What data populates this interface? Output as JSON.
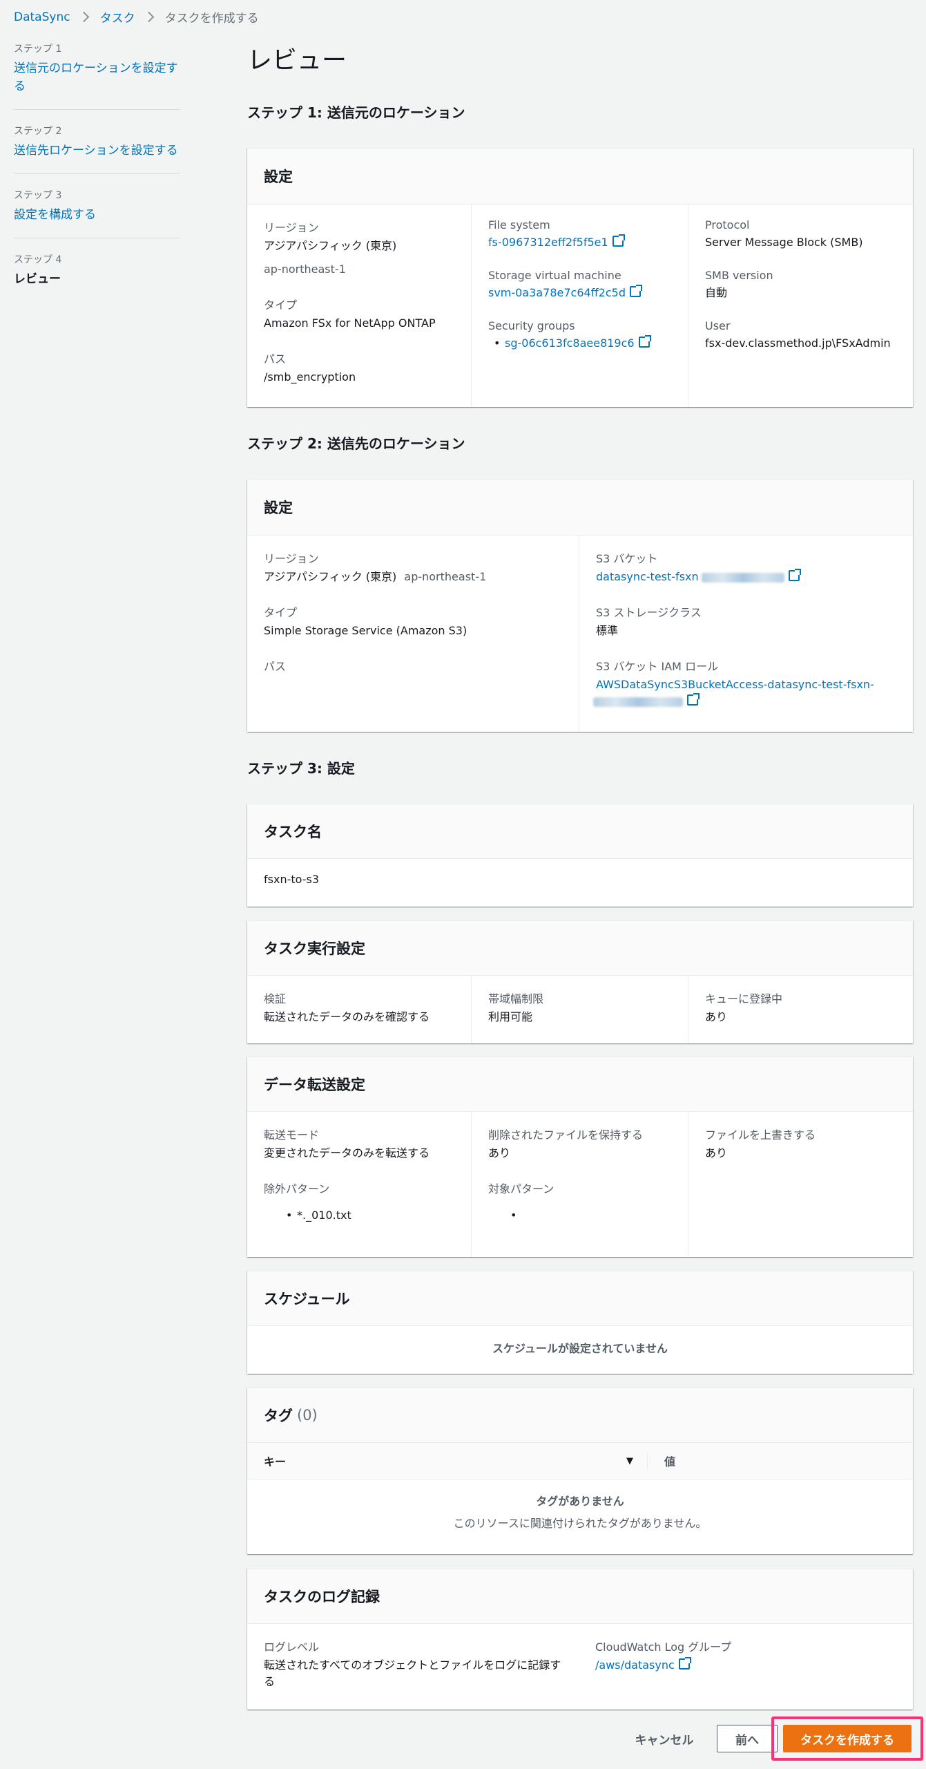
{
  "breadcrumb": {
    "items": [
      "DataSync",
      "タスク"
    ],
    "current": "タスクを作成する"
  },
  "nav": {
    "steps": [
      {
        "small": "ステップ 1",
        "label": "送信元のロケーションを設定する"
      },
      {
        "small": "ステップ 2",
        "label": "送信先ロケーションを設定する"
      },
      {
        "small": "ステップ 3",
        "label": "設定を構成する"
      },
      {
        "small": "ステップ 4",
        "label": "レビュー"
      }
    ]
  },
  "page_title": "レビュー",
  "step1": {
    "heading": "ステップ 1: 送信元のロケーション",
    "card_title": "設定",
    "region_label": "リージョン",
    "region_value": "アジアパシフィック (東京)",
    "region_code": "ap-northeast-1",
    "type_label": "タイプ",
    "type_value": "Amazon FSx for NetApp ONTAP",
    "path_label": "パス",
    "path_value": "/smb_encryption",
    "fs_label": "File system",
    "fs_value": "fs-0967312eff2f5f5e1",
    "svm_label": "Storage virtual machine",
    "svm_value": "svm-0a3a78e7c64ff2c5d",
    "sg_label": "Security groups",
    "sg_value": "sg-06c613fc8aee819c6",
    "protocol_label": "Protocol",
    "protocol_value": "Server Message Block (SMB)",
    "smbver_label": "SMB version",
    "smbver_value": "自動",
    "user_label": "User",
    "user_value": "fsx-dev.classmethod.jp\\FSxAdmin"
  },
  "step2": {
    "heading": "ステップ 2: 送信先のロケーション",
    "card_title": "設定",
    "region_label": "リージョン",
    "region_value": "アジアパシフィック (東京)",
    "region_code": "ap-northeast-1",
    "type_label": "タイプ",
    "type_value": "Simple Storage Service (Amazon S3)",
    "path_label": "パス",
    "bucket_label": "S3 バケット",
    "bucket_value": "datasync-test-fsxn",
    "storage_class_label": "S3 ストレージクラス",
    "storage_class_value": "標準",
    "iam_label": "S3 バケット IAM ロール",
    "iam_value": "AWSDataSyncS3BucketAccess-datasync-test-fsxn-"
  },
  "step3": {
    "heading": "ステップ 3: 設定",
    "task_name_title": "タスク名",
    "task_name_value": "fsxn-to-s3",
    "exec_title": "タスク実行設定",
    "verify_label": "検証",
    "verify_value": "転送されたデータのみを確認する",
    "bw_label": "帯域幅制限",
    "bw_value": "利用可能",
    "queue_label": "キューに登録中",
    "queue_value": "あり",
    "transfer_title": "データ転送設定",
    "mode_label": "転送モード",
    "mode_value": "変更されたデータのみを転送する",
    "keep_label": "削除されたファイルを保持する",
    "keep_value": "あり",
    "overwrite_label": "ファイルを上書きする",
    "overwrite_value": "あり",
    "exclude_label": "除外パターン",
    "exclude_value": "*._010.txt",
    "include_label": "対象パターン",
    "schedule_title": "スケジュール",
    "schedule_empty": "スケジュールが設定されていません",
    "tags_title": "タグ",
    "tags_count": "(0)",
    "tags_key_header": "キー",
    "tags_value_header": "値",
    "tags_empty_title": "タグがありません",
    "tags_empty_desc": "このリソースに関連付けられたタグがありません。",
    "log_title": "タスクのログ記録",
    "loglevel_label": "ログレベル",
    "loglevel_value": "転送されたすべてのオブジェクトとファイルをログに記録する",
    "cw_label": "CloudWatch Log グループ",
    "cw_value": "/aws/datasync"
  },
  "footer": {
    "cancel": "キャンセル",
    "prev": "前へ",
    "create": "タスクを作成する"
  },
  "colors": {
    "accent": "#ec7211",
    "link": "#0073bb",
    "highlight": "#ff2e78"
  }
}
